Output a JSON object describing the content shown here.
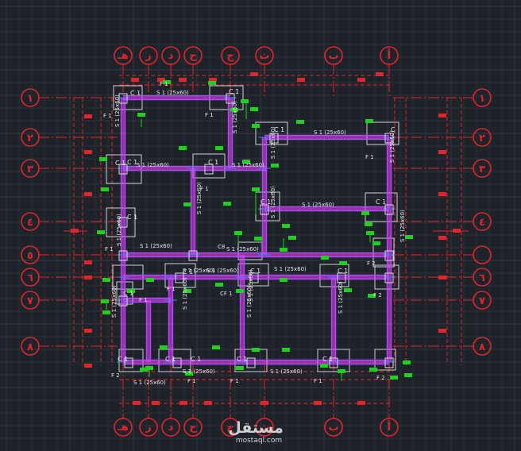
{
  "grid_axes": {
    "vertical": [
      "هـ",
      "ز",
      "د",
      "ح",
      "ج",
      "ث",
      "ب",
      "أ"
    ],
    "horizontal": [
      "١",
      "٢",
      "٣",
      "٤",
      "٥",
      "٦",
      "٧",
      "٨"
    ]
  },
  "labels": {
    "beam": "S 1 (25x60)",
    "column": "C 1",
    "column_short": "C",
    "footing1": "F 1",
    "footing2": "F 2",
    "cf1": "CF 1",
    "c8": "C8"
  },
  "watermark": {
    "logo": "مستقل",
    "url": "mostaql.com"
  },
  "colors": {
    "background": "#1e2229",
    "axis": "#e0262c",
    "beam": "#ff3df5",
    "rebar_marker": "#1ed11e"
  }
}
